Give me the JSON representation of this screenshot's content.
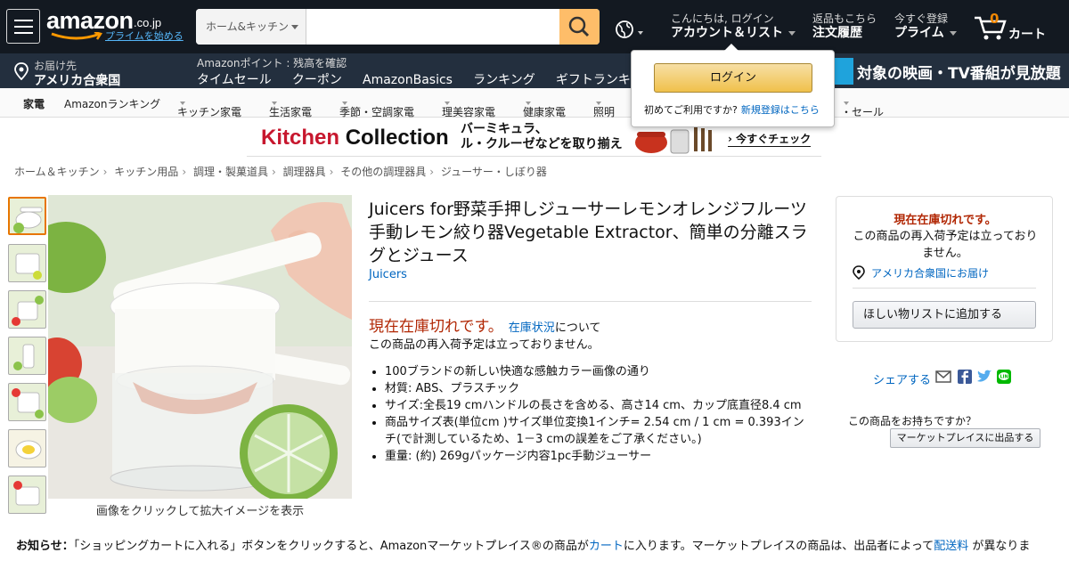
{
  "nav": {
    "logo_text": "amazon",
    "logo_suffix": ".co.jp",
    "prime_link": "プライムを始める",
    "search_category": "ホーム&キッチン",
    "search_value": "",
    "hello": "こんにちは, ログイン",
    "account": "アカウント＆リスト",
    "returns_l1": "返品もこちら",
    "returns_l2": "注文履歴",
    "prime_l1": "今すぐ登録",
    "prime_l2": "プライム",
    "cart_count": "0",
    "cart_label": "カート"
  },
  "subnav": {
    "deliver_l1": "お届け先",
    "deliver_l2": "アメリカ合衆国",
    "points": "Amazonポイント : 残高を確認",
    "links": [
      "タイムセール",
      "クーポン",
      "AmazonBasics",
      "ランキング",
      "ギフトランキング"
    ],
    "promo": "対象の映画・TV番組が見放題"
  },
  "catnav": {
    "items": [
      "家電",
      "Amazonランキング",
      "キッチン家電",
      "生活家電",
      "季節・空調家電",
      "理美容家電",
      "健康家電",
      "照明"
    ],
    "tail": "・セール"
  },
  "banner": {
    "brand_red": "Kitchen",
    "brand_black": "Collection",
    "copy_l1": "バーミキュラ、",
    "copy_l2": "ル・クルーゼなどを取り揃え",
    "cta": "› 今すぐチェック"
  },
  "breadcrumb": [
    "ホーム＆キッチン",
    "キッチン用品",
    "調理・製菓道具",
    "調理器具",
    "その他の調理器具",
    "ジューサー・しぼり器"
  ],
  "product": {
    "title": "Juicers for野菜手押しジューサーレモンオレンジフルーツ手動レモン絞り器Vegetable Extractor、簡単の分離スラグとジュース",
    "brand": "Juicers",
    "image_caption": "画像をクリックして拡大イメージを表示",
    "oos": "現在在庫切れです。",
    "oos_link": "在庫状況",
    "oos_suffix": "について",
    "restock": "この商品の再入荷予定は立っておりません。",
    "bullets": [
      "100ブランドの新しい快適な感触カラー画像の通り",
      "材質: ABS、プラスチック",
      "サイズ:全長19 cmハンドルの長さを含める、高さ14 cm、カップ底直径8.4 cm",
      "商品サイズ表(単位cm )サイズ単位変換1インチ= 2.54 cm / 1 cm = 0.393インチ(で計測しているため、1－3 cmの誤差をご了承ください。)",
      "重量: (約) 269gパッケージ内容1pc手動ジューサー"
    ]
  },
  "buybox": {
    "oos": "現在在庫切れです。",
    "restock": "この商品の再入荷予定は立っておりません。",
    "deliver": "アメリカ合衆国にお届け",
    "wishlist": "ほしい物リストに追加する"
  },
  "share": {
    "label": "シェアする"
  },
  "sell": {
    "question": "この商品をお持ちですか？",
    "button": "マーケットプレイスに出品する"
  },
  "notice": {
    "label": "お知らせ：",
    "text1": "「ショッピングカートに入れる」ボタンをクリックすると、Amazonマーケットプレイス®の商品が",
    "link1": "カート",
    "text2": "に入ります。マーケットプレイスの商品は、出品者によって",
    "link2": "配送料",
    "text3": " が異なりま"
  },
  "popover": {
    "login": "ログイン",
    "new_q": "初めてご利用ですか?",
    "new_link": "新規登録はこちら"
  },
  "colors": {
    "nav_bg": "#131921",
    "subnav_bg": "#232f3e",
    "search_btn": "#febd69",
    "oos_red": "#b12704",
    "link_blue": "#0066c0",
    "cart_orange": "#f08804"
  },
  "icons": [
    "menu-icon",
    "search-icon",
    "globe-icon",
    "cart-icon",
    "location-pin-icon",
    "mail-icon",
    "facebook-icon",
    "twitter-icon",
    "line-icon"
  ]
}
